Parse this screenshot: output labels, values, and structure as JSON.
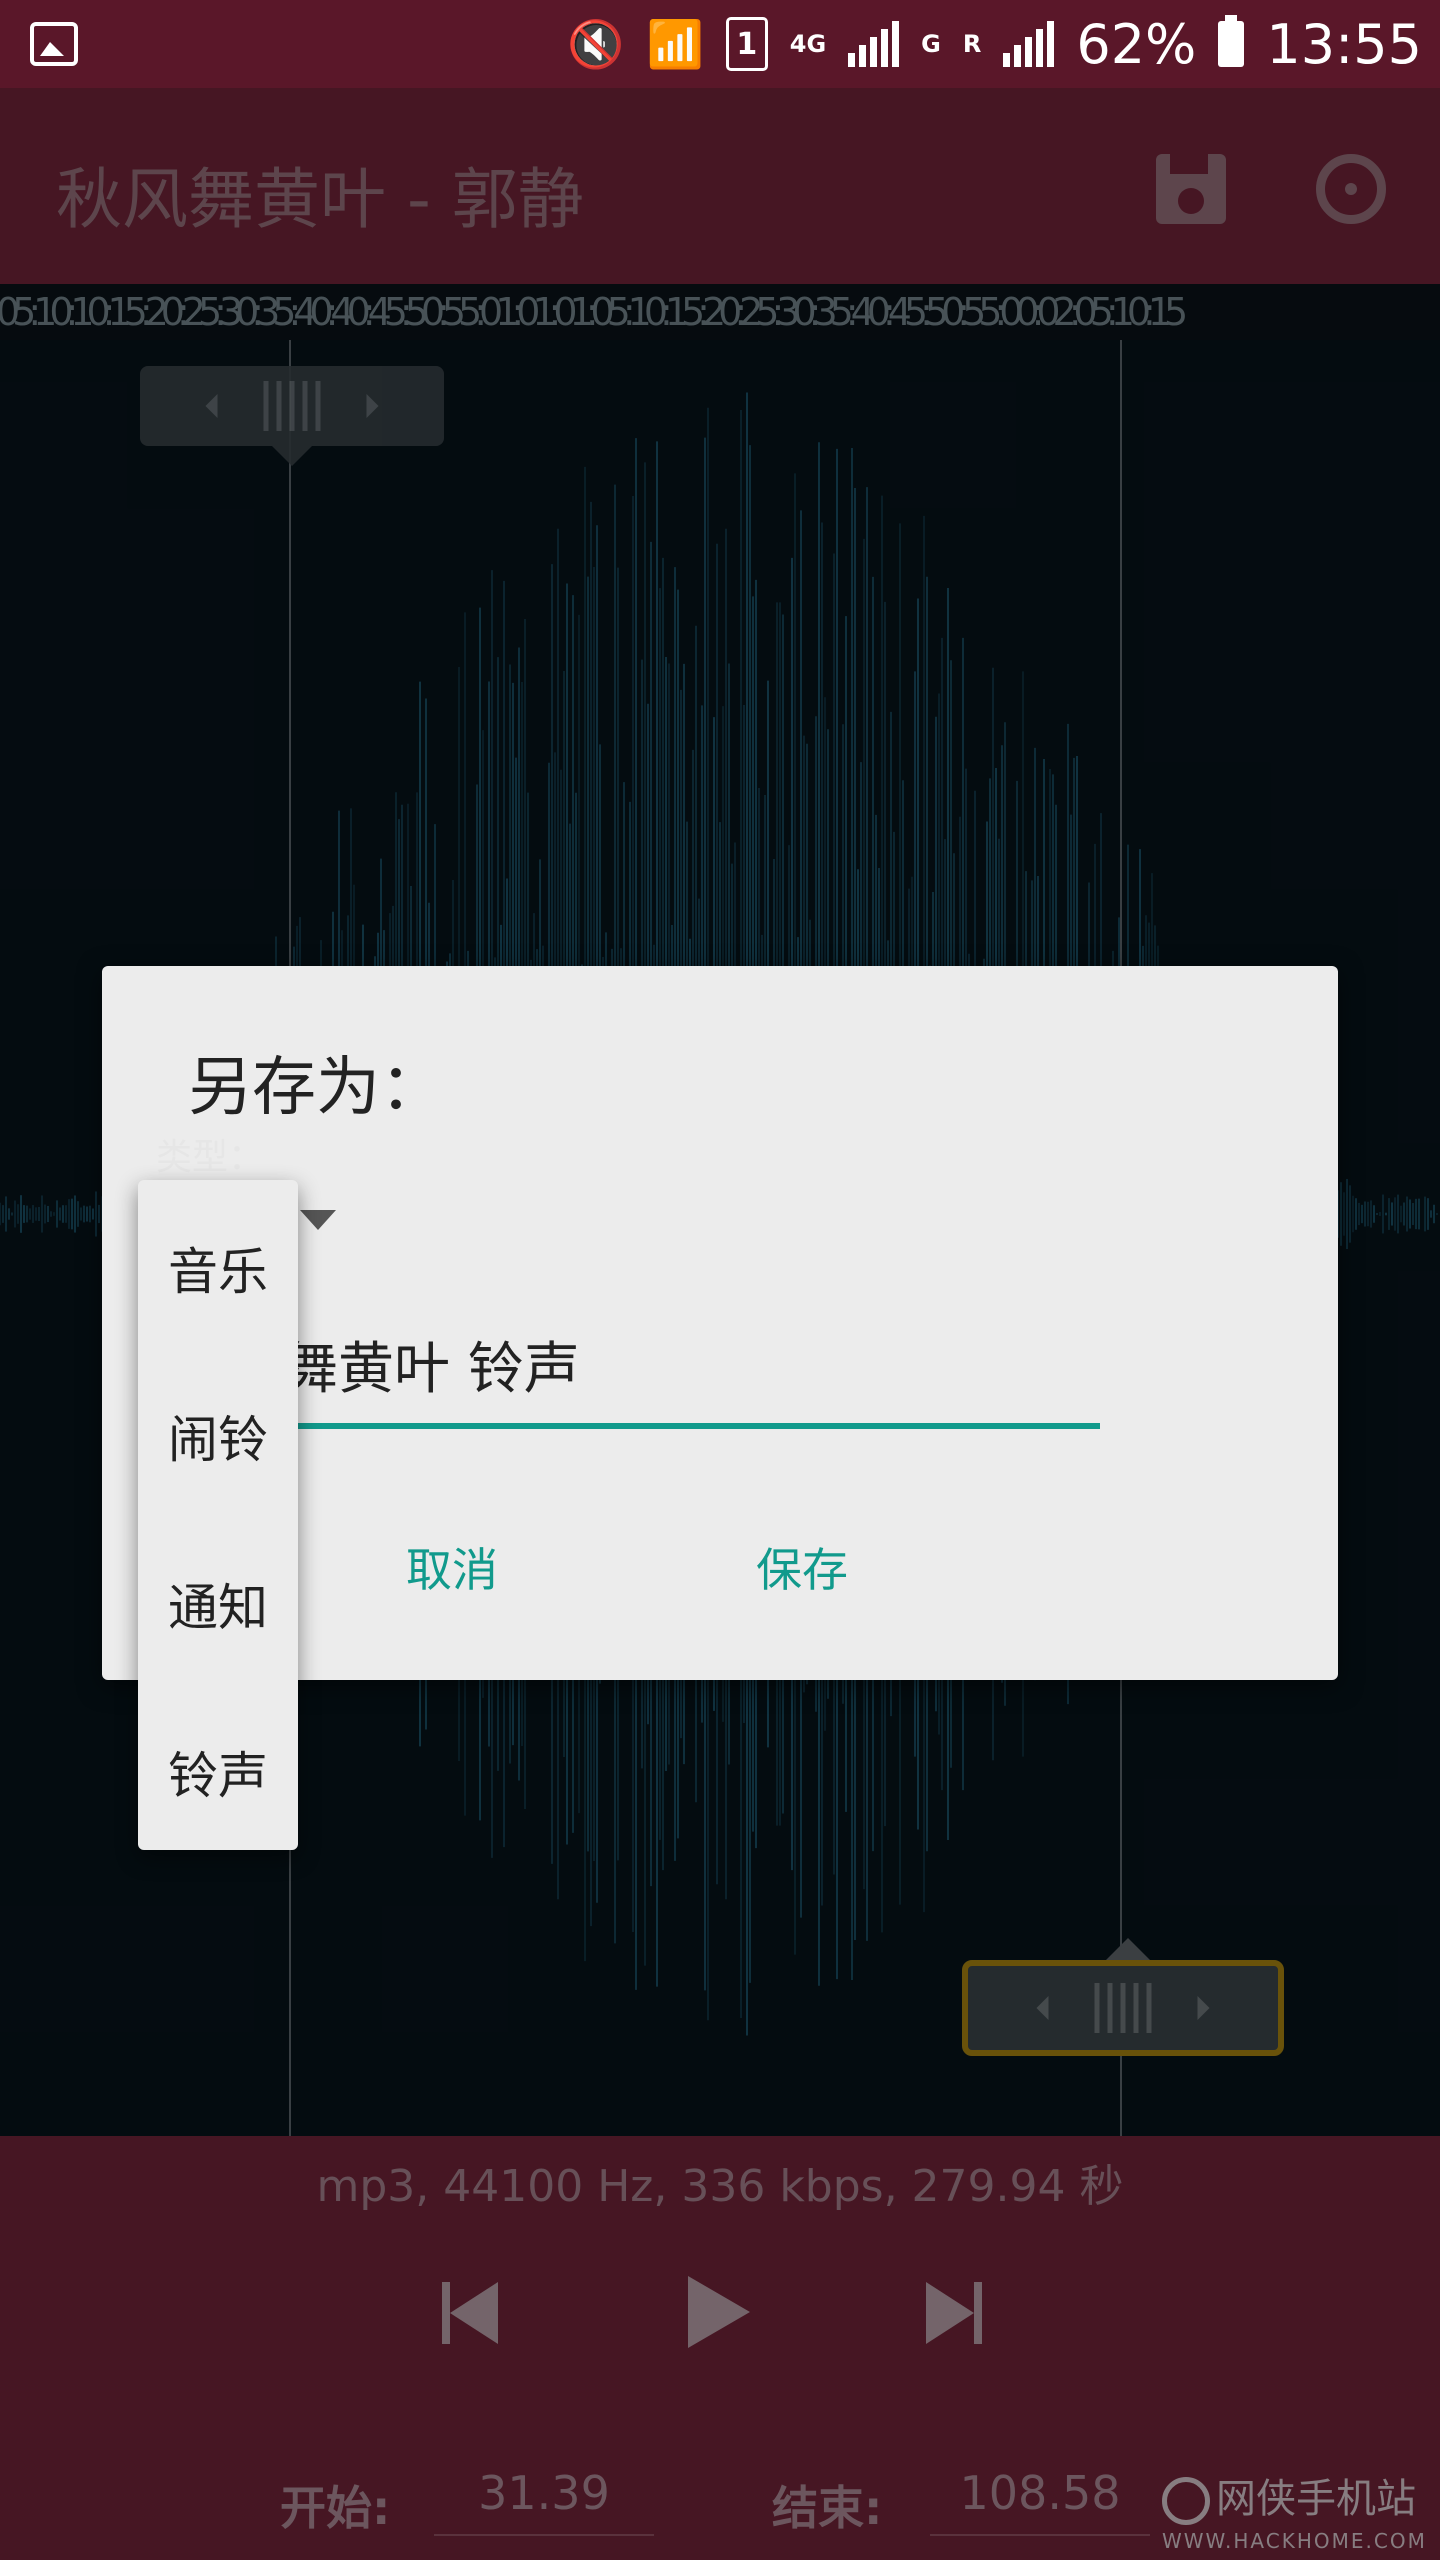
{
  "status_bar": {
    "battery": "62%",
    "time": "13:55",
    "network_4g": "4G",
    "network_g": "G",
    "network_r": "R",
    "sim_slot": "1"
  },
  "app_bar": {
    "title": "秋风舞黄叶 - 郭静",
    "save_icon": "save-icon",
    "reset_icon": "reset-icon"
  },
  "timeline": {
    "ticks_text": "05:10:10:15:20:25:30:35:40:40:45:50:55:01:01:01:05:10:15:20:25:30:35:40:45:50:55:00:02:05:10:15"
  },
  "file_info": "mp3, 44100 Hz, 336 kbps, 279.94 秒",
  "controls": {
    "start_label": "开始:",
    "start_value": "31.39",
    "end_label": "结束:",
    "end_value": "108.58"
  },
  "dialog": {
    "title": "另存为：",
    "type_label": "类型：",
    "filename": "舞黄叶 铃声",
    "cancel": "取消",
    "save": "保存"
  },
  "type_menu": {
    "options": [
      "音乐",
      "闹铃",
      "通知",
      "铃声"
    ]
  },
  "watermark": {
    "name": "网侠手机站",
    "url": "WWW.HACKHOME.COM"
  },
  "colors": {
    "status_bar": "#5a1729",
    "app_bar": "#6c2236",
    "accent": "#119a8c",
    "waveform": "#1d5a72"
  }
}
